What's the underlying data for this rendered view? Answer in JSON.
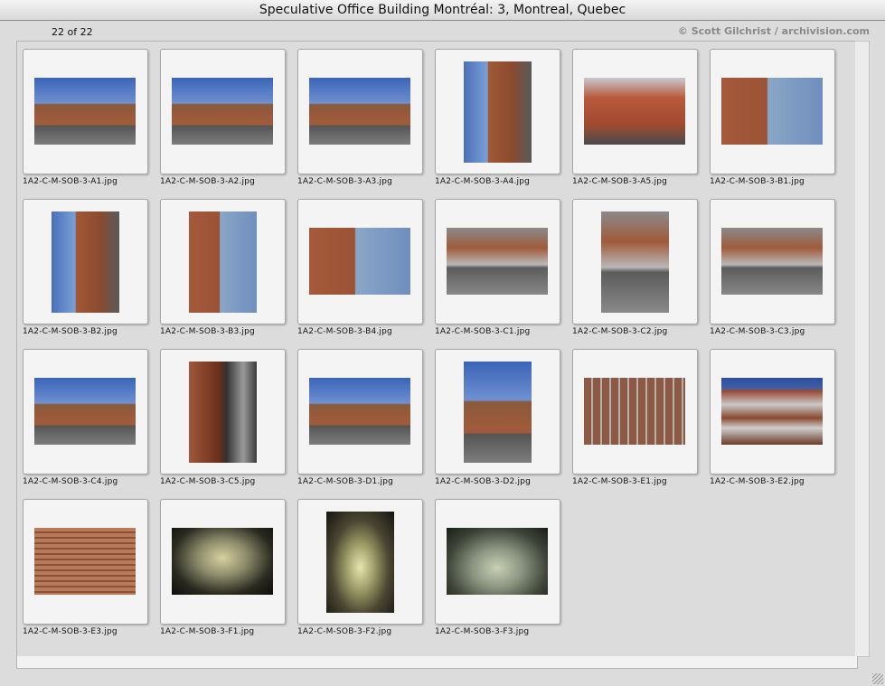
{
  "window": {
    "title": "Speculative Office Building Montréal: 3, Montreal, Quebec"
  },
  "header": {
    "counter": "22 of 22",
    "credit": "© Scott Gilchrist / archivision.com"
  },
  "images": [
    {
      "file": "1A2-C-M-SOB-3-A1.jpg"
    },
    {
      "file": "1A2-C-M-SOB-3-A2.jpg"
    },
    {
      "file": "1A2-C-M-SOB-3-A3.jpg"
    },
    {
      "file": "1A2-C-M-SOB-3-A4.jpg"
    },
    {
      "file": "1A2-C-M-SOB-3-A5.jpg"
    },
    {
      "file": "1A2-C-M-SOB-3-B1.jpg"
    },
    {
      "file": "1A2-C-M-SOB-3-B2.jpg"
    },
    {
      "file": "1A2-C-M-SOB-3-B3.jpg"
    },
    {
      "file": "1A2-C-M-SOB-3-B4.jpg"
    },
    {
      "file": "1A2-C-M-SOB-3-C1.jpg"
    },
    {
      "file": "1A2-C-M-SOB-3-C2.jpg"
    },
    {
      "file": "1A2-C-M-SOB-3-C3.jpg"
    },
    {
      "file": "1A2-C-M-SOB-3-C4.jpg"
    },
    {
      "file": "1A2-C-M-SOB-3-C5.jpg"
    },
    {
      "file": "1A2-C-M-SOB-3-D1.jpg"
    },
    {
      "file": "1A2-C-M-SOB-3-D2.jpg"
    },
    {
      "file": "1A2-C-M-SOB-3-E1.jpg"
    },
    {
      "file": "1A2-C-M-SOB-3-E2.jpg"
    },
    {
      "file": "1A2-C-M-SOB-3-E3.jpg"
    },
    {
      "file": "1A2-C-M-SOB-3-F1.jpg"
    },
    {
      "file": "1A2-C-M-SOB-3-F2.jpg"
    },
    {
      "file": "1A2-C-M-SOB-3-F3.jpg"
    }
  ]
}
